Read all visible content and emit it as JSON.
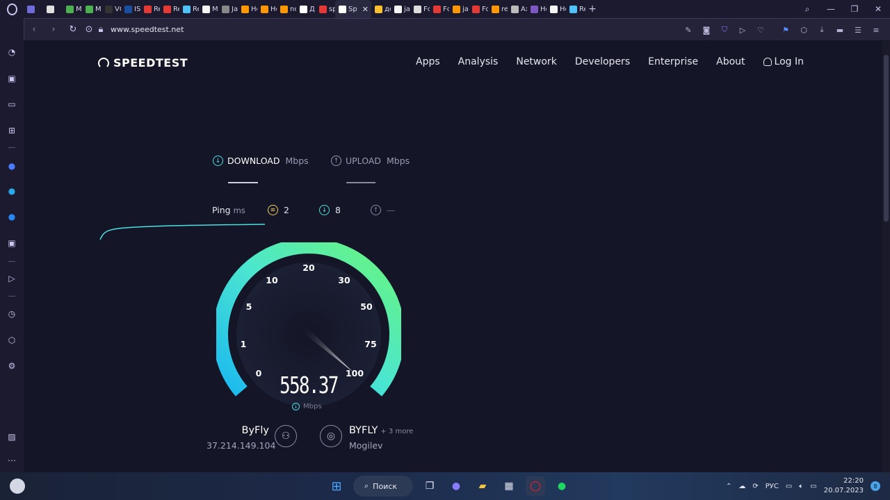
{
  "browser": {
    "tabs": [
      {
        "label": "",
        "color": "#6f6bd8"
      },
      {
        "label": "",
        "color": "#e0e0e0"
      },
      {
        "label": "M",
        "color": "#4caf50"
      },
      {
        "label": "M",
        "color": "#4caf50"
      },
      {
        "label": "VC",
        "color": "#333333"
      },
      {
        "label": "IS",
        "color": "#1a4fa0"
      },
      {
        "label": "Re",
        "color": "#e53935"
      },
      {
        "label": "Re",
        "color": "#e53935"
      },
      {
        "label": "Re",
        "color": "#4fc3f7"
      },
      {
        "label": "M",
        "color": "#f5f5f5"
      },
      {
        "label": "Ja",
        "color": "#888888"
      },
      {
        "label": "Hc",
        "color": "#ff9800"
      },
      {
        "label": "Hc",
        "color": "#ff9800"
      },
      {
        "label": "nc",
        "color": "#ff9800"
      },
      {
        "label": "Д",
        "color": "#ffffff"
      },
      {
        "label": "sp",
        "color": "#e53935"
      },
      {
        "label": "Sp",
        "color": "#ffffff",
        "active": true
      },
      {
        "label": "де",
        "color": "#fbc02d"
      },
      {
        "label": "ja",
        "color": "#f5f5f5"
      },
      {
        "label": "Fc",
        "color": "#dddddd"
      },
      {
        "label": "Fc",
        "color": "#e53935"
      },
      {
        "label": "jav",
        "color": "#ff9800"
      },
      {
        "label": "Fo",
        "color": "#e53935"
      },
      {
        "label": "re",
        "color": "#ff9800"
      },
      {
        "label": "Ax",
        "color": "#bbbbbb"
      },
      {
        "label": "Hc",
        "color": "#7e57c2"
      },
      {
        "label": "Hc",
        "color": "#f5f5f5"
      },
      {
        "label": "Re",
        "color": "#4fc3f7"
      }
    ],
    "url": "www.speedtest.net"
  },
  "page": {
    "brand": "SPEEDTEST",
    "nav": [
      "Apps",
      "Analysis",
      "Network",
      "Developers",
      "Enterprise",
      "About"
    ],
    "login": "Log In",
    "download_label": "DOWNLOAD",
    "upload_label": "UPLOAD",
    "unit": "Mbps",
    "ping_label": "Ping",
    "ping_unit": "ms",
    "ping_jitter": "2",
    "ping_download": "8",
    "ping_upload": "—",
    "gauge_ticks": [
      "0",
      "1",
      "5",
      "10",
      "20",
      "30",
      "50",
      "75",
      "100"
    ],
    "speed_value": "558.37",
    "speed_unit": "Mbps",
    "isp_name": "ByFly",
    "isp_ip": "37.214.149.104",
    "server_name": "BYFLY",
    "server_more": "+ 3 more",
    "server_city": "Mogilev"
  },
  "taskbar": {
    "search": "Поиск",
    "lang": "РУС",
    "time": "22:20",
    "date": "20.07.2023",
    "notifications": "8"
  }
}
